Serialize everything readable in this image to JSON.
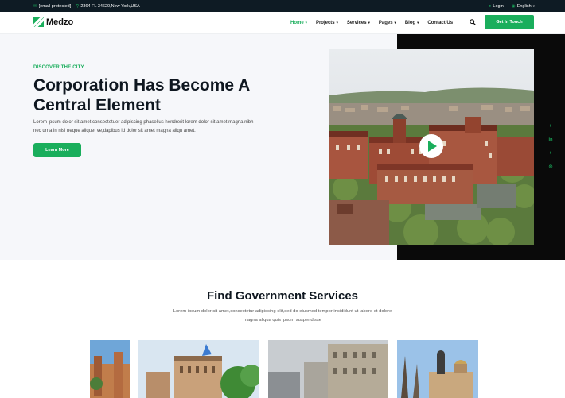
{
  "topbar": {
    "email": "[email protected]",
    "address": "2364 FL 34620,New York,USA",
    "login": "Login",
    "language": "English"
  },
  "brand": {
    "name": "Medzo",
    "accent": "#1aae5c"
  },
  "nav": {
    "items": [
      {
        "label": "Home",
        "has_caret": true,
        "active": true
      },
      {
        "label": "Projects",
        "has_caret": true,
        "active": false
      },
      {
        "label": "Services",
        "has_caret": true,
        "active": false
      },
      {
        "label": "Pages",
        "has_caret": true,
        "active": false
      },
      {
        "label": "Blog",
        "has_caret": true,
        "active": false
      },
      {
        "label": "Contact Us",
        "has_caret": false,
        "active": false
      }
    ],
    "cta": "Get In Touch",
    "search_icon": "search-icon"
  },
  "hero": {
    "eyebrow": "DISCOVER THE CITY",
    "title": "Corporation Has Become A Central Element",
    "description": "Lorem ipsum dolor sit amet consectetuer adipiscing phasellus hendrerit lorem dolor sit amet magna nibh nec urna in nisi neque aliquet ve,dapibus id dolor sit amet magna aliqu amet.",
    "button": "Learn More",
    "play_icon": "play-icon"
  },
  "socials": [
    {
      "icon": "facebook-icon",
      "glyph": "f"
    },
    {
      "icon": "linkedin-icon",
      "glyph": "in"
    },
    {
      "icon": "twitter-icon",
      "glyph": "t"
    },
    {
      "icon": "instagram-icon",
      "glyph": "◎"
    }
  ],
  "services": {
    "title": "Find Government Services",
    "description": "Lorem ipsum dolor sit amet,consectetur adipiscing elit,sed do eiusmod tempor incididunt ut labore et dolore magna aliqua quis ipsum suspendisse"
  }
}
